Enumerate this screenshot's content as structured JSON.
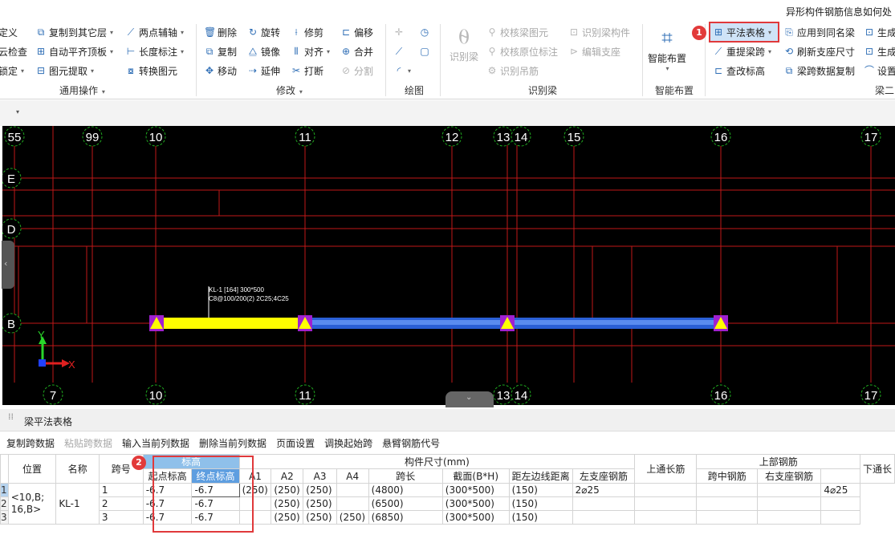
{
  "title": "异形构件钢筋信息如何处",
  "ribbon": {
    "g1": {
      "items": [
        "定义",
        "云检查",
        "锁定"
      ],
      "label": ""
    },
    "g2": {
      "items": [
        "复制到其它层",
        "自动平齐顶板",
        "图元提取"
      ],
      "label": "通用操作"
    },
    "g3": {
      "items": [
        "两点辅轴",
        "长度标注",
        "转换图元"
      ]
    },
    "g4": {
      "items": [
        "删除",
        "旋转",
        "修剪",
        "偏移",
        "复制",
        "镜像",
        "对齐",
        "合并",
        "移动",
        "延伸",
        "打断",
        "分割"
      ],
      "label": "修改"
    },
    "g5": {
      "label": "绘图"
    },
    "g6": {
      "big": "识别梁",
      "items": [
        "校核梁图元",
        "识别梁构件",
        "校核原位标注",
        "编辑支座",
        "识别吊筋"
      ],
      "label": "识别梁"
    },
    "g7": {
      "big": "智能布置",
      "label": "智能布置"
    },
    "g8": {
      "items": [
        "平法表格",
        "应用到同名梁",
        "生成",
        "重提梁跨",
        "刷新支座尺寸",
        "生成",
        "查改标高",
        "梁跨数据复制",
        "设置"
      ],
      "label": "梁二"
    },
    "badge1": "1"
  },
  "canvas": {
    "top_axes": [
      "55",
      "99",
      "10",
      "11",
      "12",
      "13",
      "14",
      "15",
      "16",
      "17"
    ],
    "bottom_axes": [
      "7",
      "10",
      "11",
      "13",
      "14",
      "16",
      "17"
    ],
    "row_axes": [
      "E",
      "D",
      "B"
    ],
    "beam_label1": "KL-1 [164] 300*500",
    "beam_label2": "C8@100/200(2) 2C25;4C25",
    "axis_y": "Y",
    "axis_x": "X"
  },
  "panel": {
    "title": "梁平法表格",
    "tools": [
      "复制跨数据",
      "粘贴跨数据",
      "输入当前列数据",
      "删除当前列数据",
      "页面设置",
      "调换起始跨",
      "悬臂钢筋代号"
    ],
    "badge2": "2",
    "headers": {
      "pos": "位置",
      "name": "名称",
      "span": "跨号",
      "elev": "标高",
      "elev_start": "起点标高",
      "elev_end": "终点标高",
      "size": "构件尺寸(mm)",
      "a1": "A1",
      "a2": "A2",
      "a3": "A3",
      "a4": "A4",
      "span_len": "跨长",
      "section": "截面(B*H)",
      "edge": "距左边线距离",
      "top_bar": "上通长筋",
      "upper": "上部钢筋",
      "left_seat": "左支座钢筋",
      "mid": "跨中钢筋",
      "right_seat": "右支座钢筋",
      "bot_bar": "下通长"
    },
    "rows": [
      {
        "n": "1",
        "span": "1",
        "s": "-6.7",
        "e": "-6.7",
        "a1": "(250)",
        "a2": "(250)",
        "a3": "(250)",
        "a4": "",
        "len": "(4800)",
        "sec": "(300*500)",
        "edge": "(150)",
        "top": "2⌀25",
        "bot": "4⌀25"
      },
      {
        "n": "2",
        "span": "2",
        "s": "-6.7",
        "e": "-6.7",
        "a1": "",
        "a2": "(250)",
        "a3": "(250)",
        "a4": "",
        "len": "(6500)",
        "sec": "(300*500)",
        "edge": "(150)",
        "top": "",
        "bot": ""
      },
      {
        "n": "3",
        "span": "3",
        "s": "-6.7",
        "e": "-6.7",
        "a1": "",
        "a2": "(250)",
        "a3": "(250)",
        "a4": "(250)",
        "len": "(6850)",
        "sec": "(300*500)",
        "edge": "(150)",
        "top": "",
        "bot": ""
      }
    ],
    "pos": "<10,B; 16,B>",
    "name": "KL-1"
  }
}
